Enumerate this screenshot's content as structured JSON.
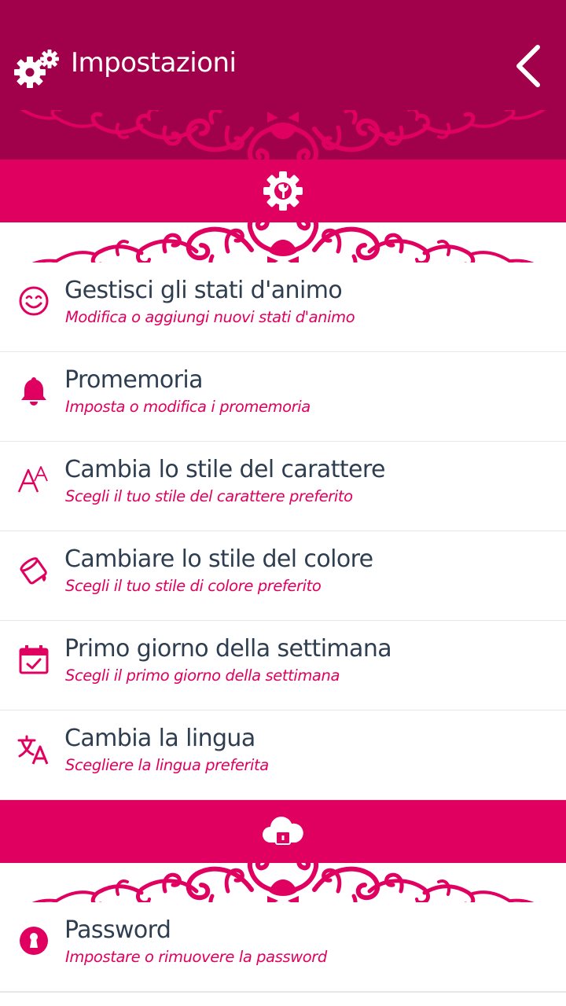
{
  "header": {
    "title": "Impostazioni"
  },
  "colors": {
    "header": "#a1004a",
    "accent": "#e0005f",
    "title_text": "#2e3e50",
    "divider": "#e6e6e6"
  },
  "sections": [
    {
      "icon": "gear-wrench-icon",
      "items": [
        {
          "icon": "smiley-icon",
          "title": "Gestisci gli stati d'animo",
          "subtitle": "Modifica o aggiungi nuovi stati d'animo"
        },
        {
          "icon": "bell-icon",
          "title": "Promemoria",
          "subtitle": "Imposta o modifica i promemoria"
        },
        {
          "icon": "font-style-icon",
          "title": "Cambia lo stile del carattere",
          "subtitle": "Scegli il tuo stile del carattere preferito"
        },
        {
          "icon": "paint-bucket-icon",
          "title": "Cambiare lo stile del colore",
          "subtitle": "Scegli il tuo stile di colore preferito"
        },
        {
          "icon": "calendar-check-icon",
          "title": "Primo giorno della settimana",
          "subtitle": "Scegli il primo giorno della settimana"
        },
        {
          "icon": "translate-icon",
          "title": "Cambia la lingua",
          "subtitle": "Scegliere la lingua preferita"
        }
      ]
    },
    {
      "icon": "cloud-lock-icon",
      "items": [
        {
          "icon": "keyhole-icon",
          "title": "Password",
          "subtitle": "Impostare o rimuovere la password"
        }
      ]
    }
  ]
}
